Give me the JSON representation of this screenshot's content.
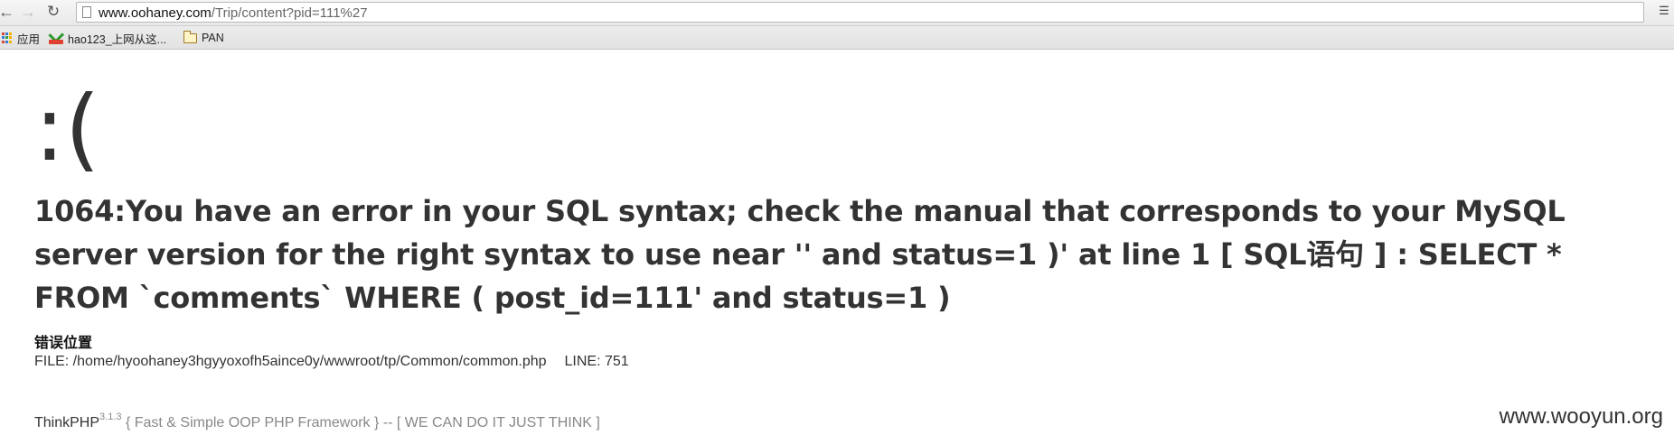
{
  "browser": {
    "url_host": "www.oohaney.com",
    "url_path": "/Trip/content?pid=111%27",
    "bookmarks": [
      {
        "label": "应用",
        "icon": "apps-icon"
      },
      {
        "label": "hao123_上网从这...",
        "icon": "hao123-icon"
      },
      {
        "label": "PAN",
        "icon": "folder-icon"
      }
    ]
  },
  "page": {
    "sad_face": ":(",
    "error_message": "1064:You have an error in your SQL syntax; check the manual that corresponds to your MySQL server version for the right syntax to use near '' and status=1 )' at line 1 [ SQL语句 ] : SELECT * FROM `comments` WHERE ( post_id=111' and status=1 )",
    "location_title": "错误位置",
    "file_text": "FILE: /home/hyoohaney3hgyyoxofh5aince0y/wwwroot/tp/Common/common.php",
    "line_text": "LINE: 751",
    "footer": {
      "brand": "ThinkPHP",
      "version": "3.1.3",
      "slogan": "{ Fast & Simple OOP PHP Framework } -- [ WE CAN DO IT JUST THINK ]"
    },
    "watermark": "www.wooyun.org"
  }
}
